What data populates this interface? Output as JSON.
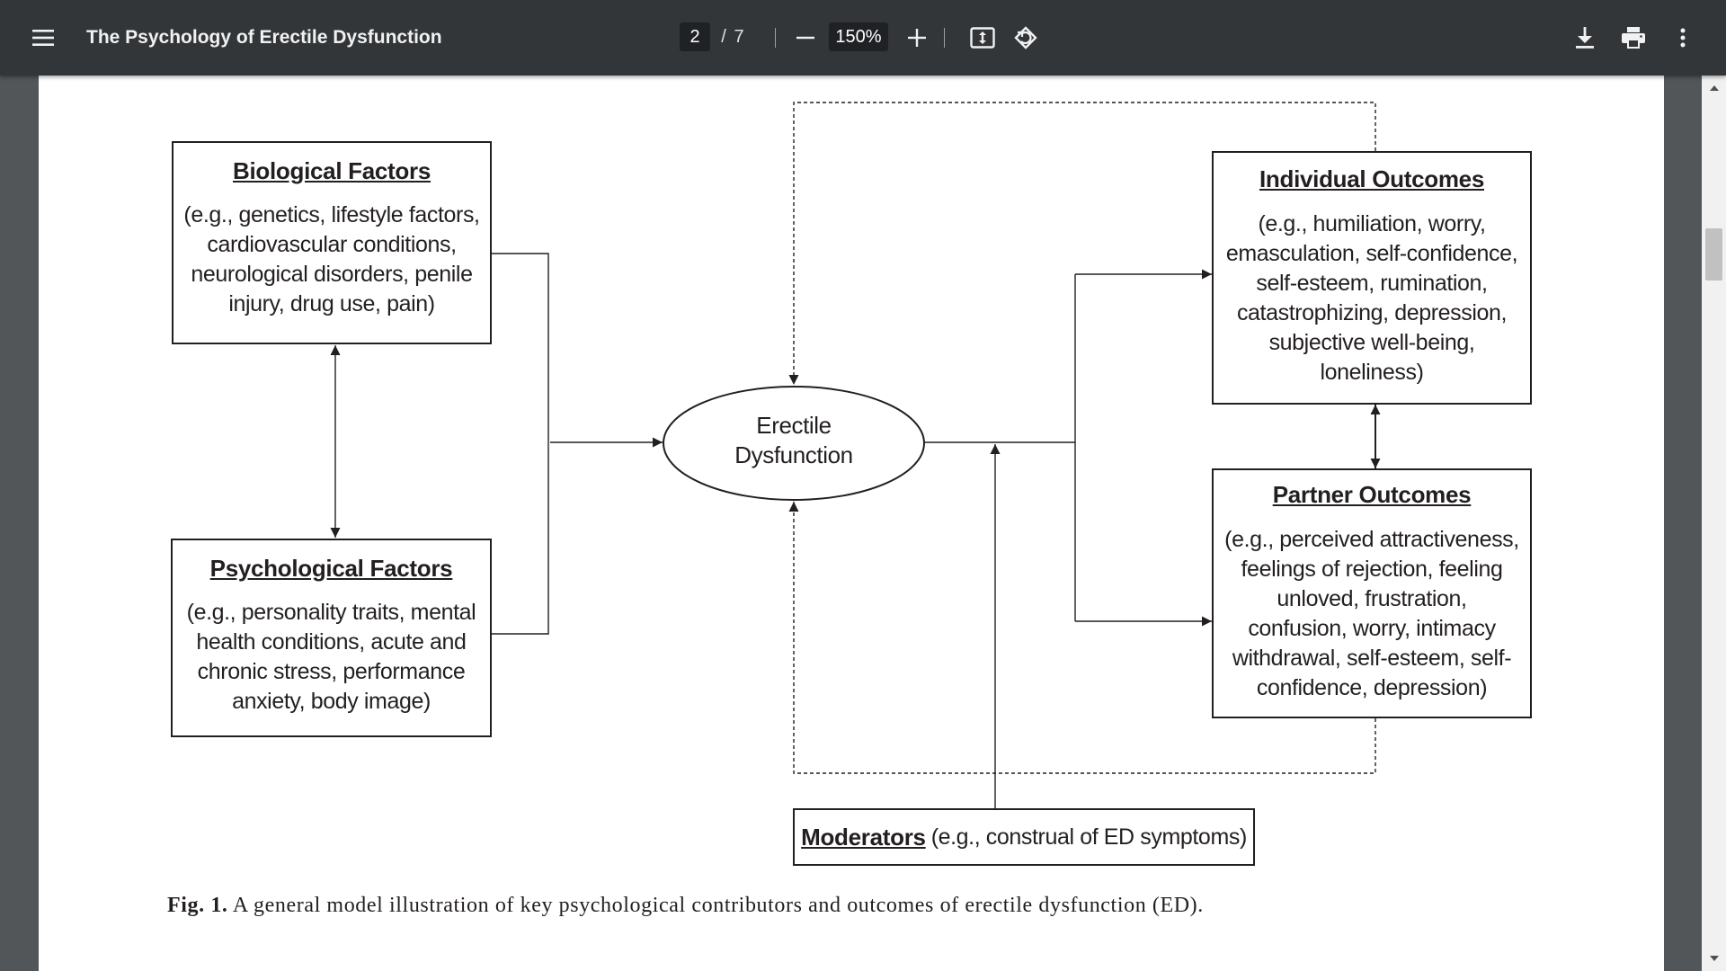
{
  "toolbar": {
    "title": "The Psychology of Erectile Dysfunction",
    "page_current": "2",
    "page_separator": "/",
    "page_total": "7",
    "zoom": "150%"
  },
  "figure": {
    "biological": {
      "title": "Biological Factors",
      "lines": [
        "(e.g., genetics, lifestyle factors,",
        "cardiovascular conditions,",
        "neurological disorders, penile",
        "injury, drug use, pain)"
      ]
    },
    "psychological": {
      "title": "Psychological Factors",
      "lines": [
        "(e.g., personality traits, mental",
        "health conditions, acute and",
        "chronic stress, performance",
        "anxiety, body image)"
      ]
    },
    "center": {
      "lines": [
        "Erectile",
        "Dysfunction"
      ]
    },
    "individual": {
      "title": "Individual Outcomes",
      "lines": [
        "(e.g., humiliation, worry,",
        "emasculation, self-confidence,",
        "self-esteem, rumination,",
        "catastrophizing, depression,",
        "subjective well-being,",
        "loneliness)"
      ]
    },
    "partner": {
      "title": "Partner Outcomes",
      "lines": [
        "(e.g., perceived attractiveness,",
        "feelings of rejection, feeling",
        "unloved, frustration,",
        "confusion, worry, intimacy",
        "withdrawal, self-esteem, self-",
        "confidence, depression)"
      ]
    },
    "moderators": {
      "title": "Moderators",
      "text": "(e.g., construal of ED symptoms)"
    },
    "caption": {
      "label": "Fig. 1.",
      "text": "A general model illustration of key psychological contributors and outcomes of erectile dysfunction (ED)."
    }
  }
}
